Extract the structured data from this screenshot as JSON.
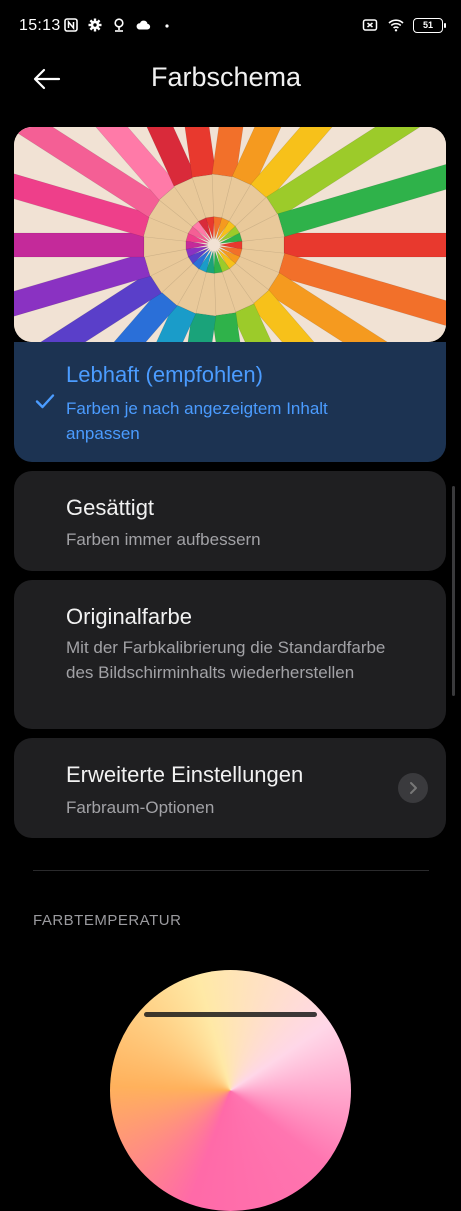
{
  "status": {
    "time": "15:13",
    "battery": "51",
    "icons_left": [
      "nfc-icon",
      "gear-icon",
      "location-pin-icon",
      "cloud-icon",
      "dot-icon"
    ],
    "icons_right": [
      "no-sim-icon",
      "wifi-icon",
      "battery-icon"
    ]
  },
  "header": {
    "title": "Farbschema"
  },
  "options": [
    {
      "title": "Lebhaft (empfohlen)",
      "subtitle": "Farben je nach angezeigtem Inhalt anpassen",
      "selected": true
    },
    {
      "title": "Gesättigt",
      "subtitle": "Farben immer aufbessern",
      "selected": false
    },
    {
      "title": "Originalfarbe",
      "subtitle": "Mit der Farbkalibrierung die Standardfarbe des Bildschirminhalts wiederherstellen",
      "selected": false
    },
    {
      "title": "Erweiterte Einstellungen",
      "subtitle": "Farbraum-Optionen",
      "selected": false
    }
  ],
  "section": {
    "label": "FARBTEMPERATUR"
  },
  "colors": {
    "background": "#000000",
    "card": "#1f1f21",
    "selected_card": "#1c3352",
    "accent": "#4b9cff"
  }
}
